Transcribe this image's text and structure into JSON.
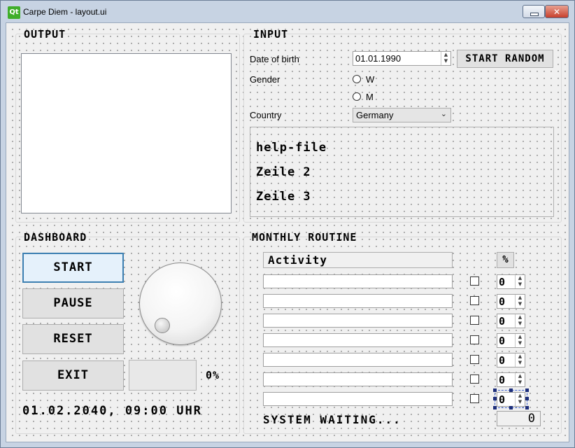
{
  "window": {
    "logo": "Qt",
    "title": "Carpe Diem - layout.ui",
    "close_glyph": "✕"
  },
  "output": {
    "heading": "OUTPUT"
  },
  "input": {
    "heading": "INPUT",
    "dob_label": "Date of birth",
    "dob_value": "01.01.1990",
    "start_random": "START RANDOM",
    "gender_label": "Gender",
    "gender_w": "W",
    "gender_m": "M",
    "country_label": "Country",
    "country_value": "Germany",
    "help_lines": [
      "help-file",
      "Zeile 2",
      "Zeile 3"
    ]
  },
  "dashboard": {
    "heading": "DASHBOARD",
    "start": "START",
    "pause": "PAUSE",
    "reset": "RESET",
    "exit": "EXIT",
    "percent": "0%",
    "datetime": "01.02.2040, 09:00 UHR"
  },
  "routine": {
    "heading": "MONTHLY ROUTINE",
    "activity_header": "Activity",
    "percent_header": "%",
    "spin_values": [
      "0",
      "0",
      "0",
      "0",
      "0",
      "0",
      "0"
    ],
    "status": "SYSTEM WAITING...",
    "lcd_value": "0"
  }
}
